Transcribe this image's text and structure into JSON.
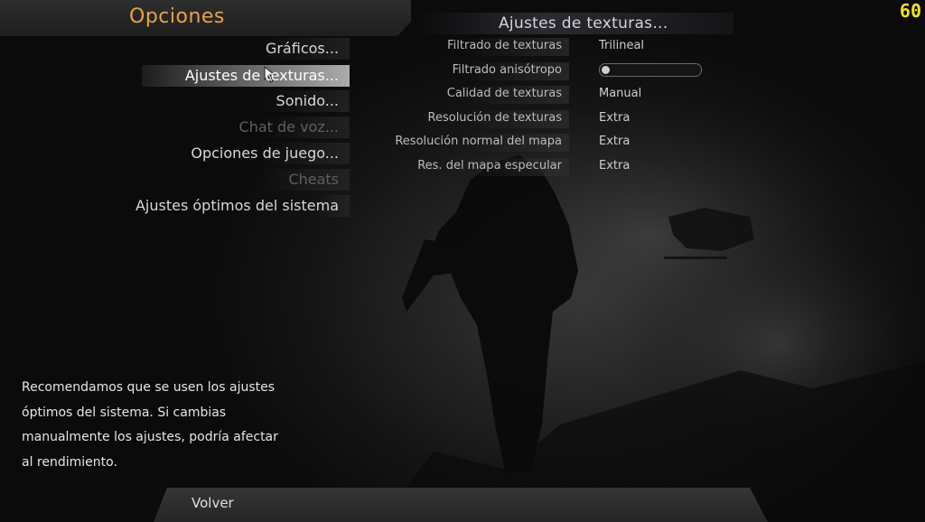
{
  "header": {
    "title": "Opciones"
  },
  "fps": "60",
  "menu": {
    "items": [
      {
        "label": "Gráficos...",
        "state": "normal"
      },
      {
        "label": "Ajustes de texturas...",
        "state": "selected"
      },
      {
        "label": "Sonido...",
        "state": "normal"
      },
      {
        "label": "Chat de voz...",
        "state": "disabled"
      },
      {
        "label": "Opciones de juego...",
        "state": "normal"
      },
      {
        "label": "Cheats",
        "state": "disabled"
      },
      {
        "label": "Ajustes óptimos del sistema",
        "state": "normal"
      }
    ]
  },
  "panel": {
    "title": "Ajustes de texturas...",
    "settings": [
      {
        "label": "Filtrado de texturas",
        "value": "Trilineal"
      },
      {
        "label": "Filtrado anisótropo",
        "value": "",
        "slider_fraction": 0.0
      },
      {
        "label": "Calidad de texturas",
        "value": "Manual"
      },
      {
        "label": "Resolución de texturas",
        "value": "Extra"
      },
      {
        "label": "Resolución normal del mapa",
        "value": "Extra"
      },
      {
        "label": "Res. del mapa especular",
        "value": "Extra"
      }
    ]
  },
  "description": {
    "lines": [
      "Recomendamos que se usen los ajustes",
      "óptimos del sistema. Si cambias",
      "manualmente los ajustes, podría afectar",
      "al rendimiento."
    ]
  },
  "footer": {
    "back_label": "Volver"
  },
  "colors": {
    "title_accent": "#e8a24a",
    "fps": "#f2e21c",
    "disabled_text": "#5f5f5f"
  }
}
